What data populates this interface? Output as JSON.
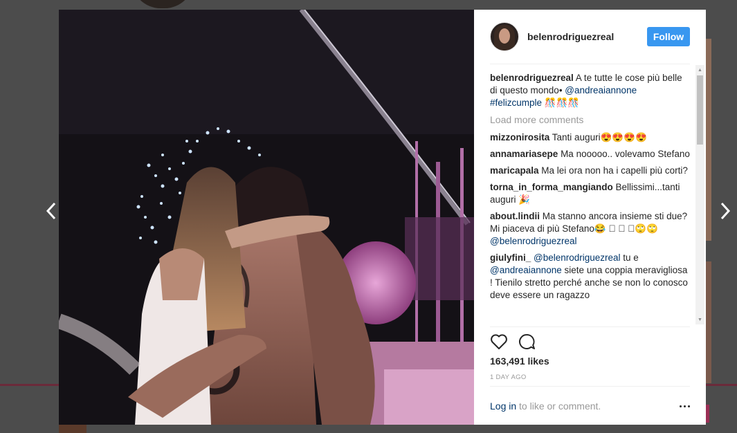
{
  "post": {
    "username": "belenrodriguezreal",
    "follow_label": "Follow",
    "caption": {
      "user": "belenrodriguezreal",
      "text": " A te tutte le cose più belle di questo mondo• ",
      "mention": "@andreaiannone",
      "hashtag": "#felizcumple",
      "emoji": " 🎊🎊🎊"
    },
    "load_more_label": "Load more comments",
    "comments": [
      {
        "user": "mizzonirosita",
        "text": " Tanti auguri😍😍😍😍"
      },
      {
        "user": "annamariasepe",
        "text": " Ma nooooo.. volevamo Stefano"
      },
      {
        "user": "maricapala",
        "text": " Ma lei ora non ha i capelli più corti?"
      },
      {
        "user": "torna_in_forma_mangiando",
        "text": " Bellissimi...tanti auguri 🎉"
      },
      {
        "user": "about.lindii",
        "text": " Ma stanno ancora insieme sti due? Mi piaceva di più Stefano😂 ⃣ ⃣ ⃣🙄🙄 ",
        "mention": "@belenrodriguezreal"
      },
      {
        "user": "giulyfini_",
        "mention_before": " @belenrodriguezreal",
        "text": " tu e ",
        "mention": "@andreaiannone",
        "text_after": " siete una coppia meravigliosa ! Tienilo stretto perché anche se non lo conosco deve essere un ragazzo"
      }
    ],
    "likes": "163,491 likes",
    "time": "1 DAY AGO",
    "login_link": "Log in",
    "login_text": " to like or comment."
  },
  "icons": {
    "prev": "chevron-left-icon",
    "next": "chevron-right-icon",
    "like": "heart-icon",
    "comment": "comment-bubble-icon",
    "more": "more-options-icon"
  },
  "colors": {
    "follow": "#3897f0",
    "link": "#003569",
    "muted": "#999999",
    "overlay": "#4c4c4c"
  }
}
